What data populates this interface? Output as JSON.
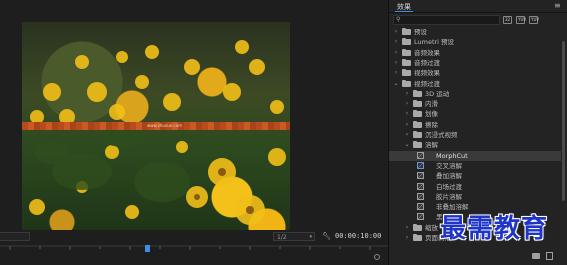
{
  "effects_panel": {
    "title": "效果",
    "menu_icon": "hamburger-menu-icon",
    "search": {
      "placeholder": "",
      "icon": "search-icon"
    },
    "bin_buttons": [
      "32",
      "YUV",
      "YUV"
    ],
    "tree": [
      {
        "label": "预设",
        "kind": "folder",
        "expanded": false,
        "depth": 0
      },
      {
        "label": "Lumetri 预设",
        "kind": "folder",
        "expanded": false,
        "depth": 0
      },
      {
        "label": "音频效果",
        "kind": "folder",
        "expanded": false,
        "depth": 0
      },
      {
        "label": "音频过渡",
        "kind": "folder",
        "expanded": false,
        "depth": 0
      },
      {
        "label": "视频效果",
        "kind": "folder",
        "expanded": false,
        "depth": 0
      },
      {
        "label": "视频过渡",
        "kind": "folder",
        "expanded": true,
        "depth": 0
      },
      {
        "label": "3D 运动",
        "kind": "folder",
        "expanded": false,
        "depth": 1
      },
      {
        "label": "内滑",
        "kind": "folder",
        "expanded": false,
        "depth": 1
      },
      {
        "label": "划像",
        "kind": "folder",
        "expanded": false,
        "depth": 1
      },
      {
        "label": "擦除",
        "kind": "folder",
        "expanded": false,
        "depth": 1
      },
      {
        "label": "沉浸式视频",
        "kind": "folder",
        "expanded": false,
        "depth": 1
      },
      {
        "label": "溶解",
        "kind": "folder",
        "expanded": true,
        "depth": 1
      },
      {
        "label": "MorphCut",
        "kind": "effect",
        "depth": 2,
        "selected": true
      },
      {
        "label": "交叉溶解",
        "kind": "effect",
        "depth": 2,
        "blue": true
      },
      {
        "label": "叠加溶解",
        "kind": "effect",
        "depth": 2
      },
      {
        "label": "白场过渡",
        "kind": "effect",
        "depth": 2
      },
      {
        "label": "胶片溶解",
        "kind": "effect",
        "depth": 2
      },
      {
        "label": "非叠加溶解",
        "kind": "effect",
        "depth": 2
      },
      {
        "label": "黑场过渡",
        "kind": "effect",
        "depth": 2
      },
      {
        "label": "缩放",
        "kind": "folder",
        "expanded": false,
        "depth": 1
      },
      {
        "label": "页面剥落",
        "kind": "folder",
        "expanded": false,
        "depth": 1
      }
    ]
  },
  "monitor": {
    "zoom_dropdown": "",
    "resolution_dropdown": "1/2",
    "settings_icon": "wrench-icon",
    "timecode": "00:00:10:00",
    "overlay_text": "www.zhuxue.com"
  },
  "watermark": "最需教育",
  "colors": {
    "accent_blue": "#3b8ee6",
    "panel_bg": "#232323",
    "mosaic_orange": "#b84a1d",
    "watermark_blue": "#1f35c8"
  }
}
